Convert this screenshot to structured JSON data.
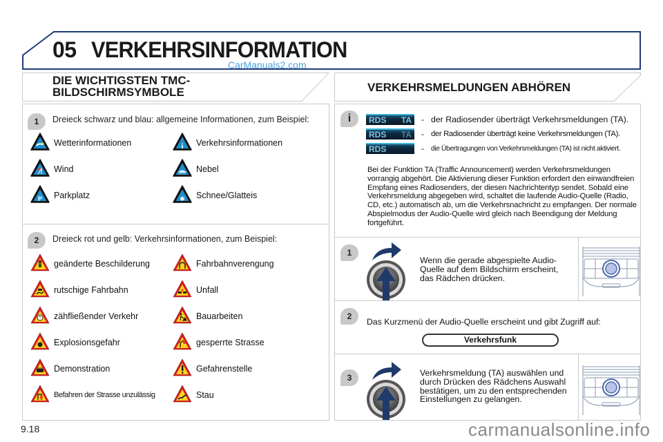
{
  "header": {
    "chapter_number": "05",
    "chapter_title": "VERKEHRSINFORMATION",
    "watermark": "CarManuals2.com"
  },
  "left_section": {
    "title_line1": "DIE WICHTIGSTEN TMC-",
    "title_line2": "BILDSCHIRMSYMBOLE",
    "group1": {
      "step": "1",
      "intro": "Dreieck schwarz und blau: allgemeine Informationen, zum Beispiel:",
      "sign_style": "blue",
      "items": [
        {
          "label": "Wetterinformationen",
          "icon": "weather-icon"
        },
        {
          "label": "Verkehrsinformationen",
          "icon": "info-icon"
        },
        {
          "label": "Wind",
          "icon": "wind-icon"
        },
        {
          "label": "Nebel",
          "icon": "fog-icon"
        },
        {
          "label": "Parkplatz",
          "icon": "parking-icon"
        },
        {
          "label": "Schnee/Glatteis",
          "icon": "snowflake-icon"
        }
      ]
    },
    "group2": {
      "step": "2",
      "intro": "Dreieck rot und gelb: Verkehrsinformationen, zum Beispiel:",
      "sign_style": "warning",
      "items": [
        {
          "label": "geänderte Beschilderung",
          "icon": "traffic-light-icon"
        },
        {
          "label": "Fahrbahnverengung",
          "icon": "road-narrows-icon"
        },
        {
          "label": "rutschige Fahrbahn",
          "icon": "slippery-road-icon"
        },
        {
          "label": "Unfall",
          "icon": "accident-icon"
        },
        {
          "label": "zähfließender Verkehr",
          "icon": "slow-traffic-icon"
        },
        {
          "label": "Bauarbeiten",
          "icon": "roadworks-icon"
        },
        {
          "label": "Explosionsgefahr",
          "icon": "explosion-icon"
        },
        {
          "label": "gesperrte Strasse",
          "icon": "road-closed-icon"
        },
        {
          "label": "Demonstration",
          "icon": "demonstration-icon"
        },
        {
          "label": "Gefahrenstelle",
          "icon": "exclamation-icon"
        },
        {
          "label": "Befahren der Strasse unzulässig",
          "icon": "no-entry-road-icon"
        },
        {
          "label": "Stau",
          "icon": "traffic-jam-icon"
        }
      ]
    }
  },
  "right_section": {
    "title": "VERKEHRSMELDUNGEN ABHÖREN",
    "info_badge": "i",
    "rds_states": [
      {
        "rds": "RDS",
        "ta": "TA",
        "ta_state": "active",
        "dash": "-",
        "description": "der Radiosender überträgt Verkehrsmeldungen (TA)."
      },
      {
        "rds": "RDS",
        "ta": "TA",
        "ta_state": "dimmed",
        "dash": "-",
        "description": "der Radiosender überträgt keine Verkehrsmeldungen (TA)."
      },
      {
        "rds": "RDS",
        "ta": "",
        "ta_state": "off",
        "dash": "-",
        "description": "die Übertragungen von Verkehrsmeldungen (TA) ist nicht aktiviert."
      }
    ],
    "info_paragraph": "Bei der Funktion TA (Traffic Announcement) werden Verkehrsmeldungen vorrangig abgehört. Die Aktivierung dieser Funktion erfordert den einwandfreien Empfang eines Radiosenders, der diesen Nachrichtentyp sendet. Sobald eine Verkehrsmeldung abgegeben wird, schaltet die laufende Audio-Quelle (Radio, CD, etc.) automatisch ab, um die Verkehrsnachricht zu empfangen. Der normale Abspielmodus der Audio-Quelle wird gleich nach Beendigung der Meldung fortgeführt.",
    "steps": [
      {
        "number": "1",
        "text": "Wenn die gerade abgespielte Audio-Quelle auf dem Bildschirm erscheint, das Rädchen drücken."
      },
      {
        "number": "2",
        "text": "Das Kurzmenü der Audio-Quelle erscheint und gibt Zugriff auf:",
        "menu_button": "Verkehrsfunk"
      },
      {
        "number": "3",
        "text": "Verkehrsmeldung (TA) auswählen und durch Drücken des Rädchens Auswahl bestätigen, um zu den entsprechenden Einstellungen zu gelangen."
      }
    ]
  },
  "footer": {
    "page_number": "9.18",
    "watermark": "carmanualsonline.info"
  },
  "colors": {
    "frame_blue": "#1f3a7a",
    "sign_blue": "#1e8fc9",
    "sign_red": "#d42020",
    "sign_yellow": "#ffd21e",
    "knob_arrow": "#1f3a6b",
    "rds_cyan": "#38b4e0"
  }
}
